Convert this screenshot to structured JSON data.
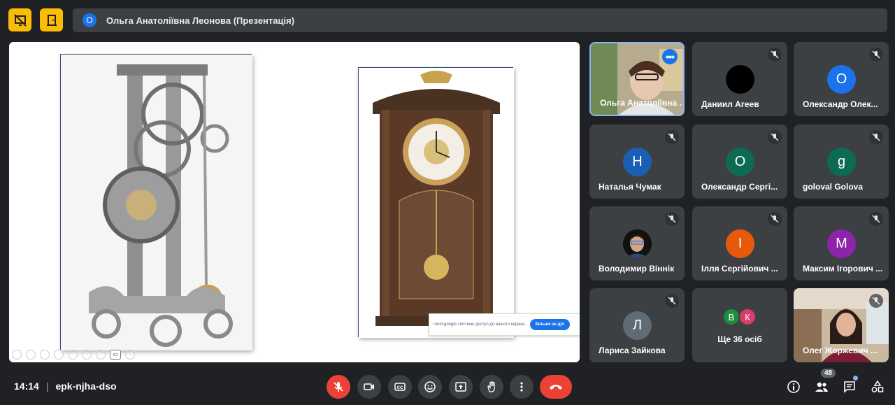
{
  "presenter_bar": {
    "avatar_letter": "О",
    "title": "Ольга Анатоліївна Леонова (Презентація)"
  },
  "presentation": {
    "share_notice_text": "meet.google.com має доступ до вашого екрана.",
    "share_notice_button": "Більше не діл"
  },
  "participants": [
    {
      "name": "Ольга Анатоліївна ...",
      "type": "video",
      "active": true
    },
    {
      "name": "Даниил Агеев",
      "avatar_letter": "",
      "avatar_color": "#000000"
    },
    {
      "name": "Олександр Олек...",
      "avatar_letter": "О",
      "avatar_color": "#1a73e8"
    },
    {
      "name": "Наталья Чумак",
      "avatar_letter": "Н",
      "avatar_color": "#1a5fb4"
    },
    {
      "name": "Олександр Сергі...",
      "avatar_letter": "О",
      "avatar_color": "#0d6b54"
    },
    {
      "name": "goloval Golova",
      "avatar_letter": "g",
      "avatar_color": "#0d6b54"
    },
    {
      "name": "Володимир Віннік",
      "type": "photo"
    },
    {
      "name": "Ілля Сергійович ...",
      "avatar_letter": "І",
      "avatar_color": "#e8590c"
    },
    {
      "name": "Максим Ігорович ...",
      "avatar_letter": "М",
      "avatar_color": "#8e24aa"
    },
    {
      "name": "Лариса Зайкова",
      "avatar_letter": "Л",
      "avatar_color": "#5f6b75"
    },
    {
      "name": "Ще 36 осіб",
      "group_letters": [
        "В",
        "К"
      ],
      "group_colors": [
        "#1e8e3e",
        "#d93b6a"
      ]
    },
    {
      "name": "Олег Жоржевич ...",
      "type": "video"
    }
  ],
  "footer": {
    "time": "14:14",
    "separator": "|",
    "meeting_code": "epk-njha-dso",
    "participants_count": "48"
  },
  "colors": {
    "background": "#202124",
    "tile": "#3c4043",
    "accent_blue": "#1a73e8",
    "end_call": "#ea4335",
    "top_button": "#fbbc04"
  }
}
